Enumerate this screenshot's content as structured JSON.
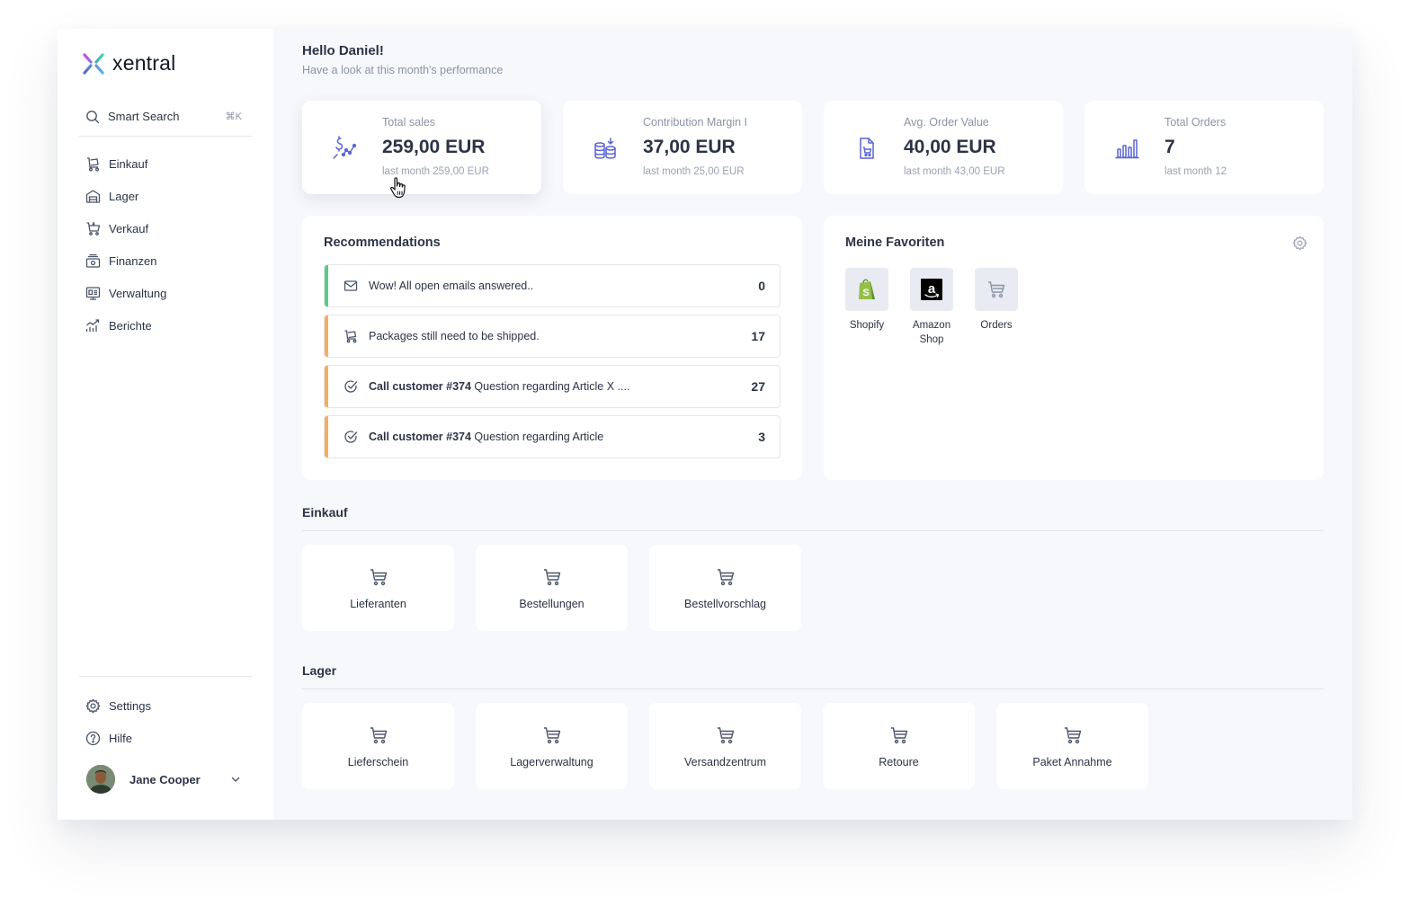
{
  "brand": {
    "name": "xentral"
  },
  "sidebar": {
    "search": {
      "label": "Smart Search",
      "shortcut": "⌘K"
    },
    "items": [
      {
        "label": "Einkauf",
        "icon": "cart-trolley-icon"
      },
      {
        "label": "Lager",
        "icon": "warehouse-icon"
      },
      {
        "label": "Verkauf",
        "icon": "shopping-cart-icon"
      },
      {
        "label": "Finanzen",
        "icon": "finance-icon"
      },
      {
        "label": "Verwaltung",
        "icon": "admin-icon"
      },
      {
        "label": "Berichte",
        "icon": "reports-icon"
      }
    ],
    "bottom": [
      {
        "label": "Settings",
        "icon": "gear-icon"
      },
      {
        "label": "Hilfe",
        "icon": "help-icon"
      }
    ],
    "user": {
      "name": "Jane Cooper"
    }
  },
  "header": {
    "greeting": "Hello Daniel!",
    "subtitle": "Have a look at this month's performance"
  },
  "stats": [
    {
      "label": "Total sales",
      "value": "259,00 EUR",
      "sub": "last month 259,00 EUR",
      "icon": "sales-icon"
    },
    {
      "label": "Contribution Margin I",
      "value": "37,00 EUR",
      "sub": "last month 25,00 EUR",
      "icon": "coins-icon"
    },
    {
      "label": "Avg. Order Value",
      "value": "40,00 EUR",
      "sub": "last month 43,00 EUR",
      "icon": "order-bag-icon"
    },
    {
      "label": "Total Orders",
      "value": "7",
      "sub": "last month 12",
      "icon": "bar-chart-icon"
    }
  ],
  "recommendations": {
    "title": "Recommendations",
    "items": [
      {
        "bold": "",
        "text": "Wow! All open emails answered..",
        "count": "0",
        "status_color": "#5cc98a",
        "icon": "mail-icon"
      },
      {
        "bold": "",
        "text": "Packages still need to be shipped.",
        "count": "17",
        "status_color": "#f6ad5e",
        "icon": "trolley-icon"
      },
      {
        "bold": "Call customer #374",
        "text": " Question regarding Article X ....",
        "count": "27",
        "status_color": "#f6ad5e",
        "icon": "check-circle-icon"
      },
      {
        "bold": "Call customer #374",
        "text": " Question regarding Article",
        "count": "3",
        "status_color": "#f6ad5e",
        "icon": "check-circle-icon"
      }
    ]
  },
  "favorites": {
    "title": "Meine Favoriten",
    "items": [
      {
        "label": "Shopify",
        "icon": "shopify-icon"
      },
      {
        "label": "Amazon Shop",
        "icon": "amazon-icon"
      },
      {
        "label": "Orders",
        "icon": "cart-icon"
      }
    ]
  },
  "sections": [
    {
      "title": "Einkauf",
      "tiles": [
        "Lieferanten",
        "Bestellungen",
        "Bestellvorschlag"
      ]
    },
    {
      "title": "Lager",
      "tiles": [
        "Lieferschein",
        "Lagerverwaltung",
        "Versandzentrum",
        "Retoure",
        "Paket Annahme"
      ]
    }
  ],
  "colors": {
    "accent": "#5b63d3",
    "success": "#5cc98a",
    "warning": "#f6ad5e",
    "background": "#f7f8fc"
  }
}
